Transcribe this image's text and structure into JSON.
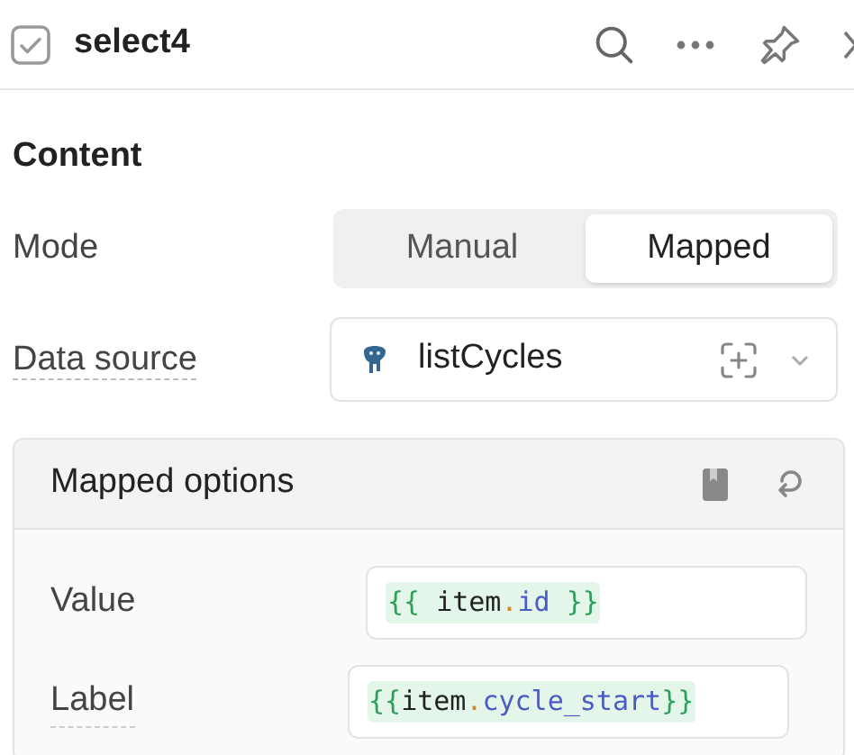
{
  "header": {
    "title": "select4"
  },
  "section": {
    "title": "Content"
  },
  "mode": {
    "label": "Mode",
    "options": [
      {
        "label": "Manual",
        "selected": false
      },
      {
        "label": "Mapped",
        "selected": true
      }
    ]
  },
  "data_source": {
    "label": "Data source",
    "value": "listCycles"
  },
  "mapped_options": {
    "title": "Mapped options",
    "fields": [
      {
        "label": "Value",
        "tokens": [
          {
            "text": "{{ ",
            "kind": "brace"
          },
          {
            "text": "item",
            "kind": "var"
          },
          {
            "text": ".",
            "kind": "dot"
          },
          {
            "text": "id",
            "kind": "prop"
          },
          {
            "text": " }}",
            "kind": "brace"
          }
        ]
      },
      {
        "label": "Label",
        "tokens": [
          {
            "text": "{{",
            "kind": "brace"
          },
          {
            "text": "item",
            "kind": "var"
          },
          {
            "text": ".",
            "kind": "dot"
          },
          {
            "text": "cycle_start",
            "kind": "prop"
          },
          {
            "text": "}}",
            "kind": "brace"
          }
        ]
      }
    ]
  }
}
